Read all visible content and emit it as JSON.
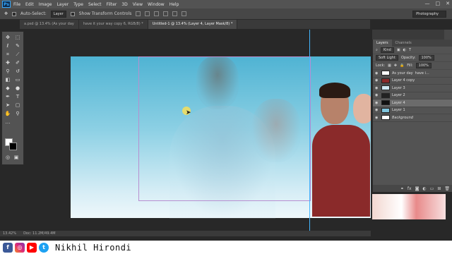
{
  "app": {
    "logo": "Ps",
    "menu": [
      "File",
      "Edit",
      "Image",
      "Layer",
      "Type",
      "Select",
      "Filter",
      "3D",
      "View",
      "Window",
      "Help"
    ],
    "window_controls": [
      "—",
      "□",
      "✕"
    ]
  },
  "options_bar": {
    "auto_select_label": "Auto-Select:",
    "auto_select_value": "Layer",
    "transform_label": "Show Transform Controls",
    "workspace": "Photography"
  },
  "tabs": [
    {
      "label": "a.psd @ 13.4% (As your day",
      "active": false
    },
    {
      "label": "have it your way copy 6, RGB/8) *",
      "active": false
    },
    {
      "label": "Untitled-1 @ 13.4% (Layer 4, Layer Mask/8) *",
      "active": true
    }
  ],
  "statusbar": {
    "zoom": "13.42%",
    "doc": "Doc: 11.2M/49.4M"
  },
  "layers_panel": {
    "tabs": [
      "Layers",
      "Channels"
    ],
    "kind_label": "Kind",
    "blend_mode": "Soft Light",
    "opacity_label": "Opacity:",
    "opacity_value": "100%",
    "lock_label": "Lock:",
    "fill_label": "Fill:",
    "fill_value": "100%",
    "layers": [
      {
        "name": "As your day",
        "extra": "have i...",
        "selected": false,
        "visible": true
      },
      {
        "name": "Layer 4 copy",
        "extra": "",
        "selected": false,
        "visible": true
      },
      {
        "name": "Layer 3",
        "extra": "",
        "selected": false,
        "visible": true
      },
      {
        "name": "Layer 2",
        "extra": "",
        "selected": false,
        "visible": true
      },
      {
        "name": "Layer 4",
        "extra": "",
        "selected": true,
        "visible": true
      },
      {
        "name": "Layer 1",
        "extra": "",
        "selected": false,
        "visible": true
      },
      {
        "name": "Background",
        "extra": "",
        "selected": false,
        "visible": true
      }
    ]
  },
  "footer": {
    "author": "Nikhil Hirondi"
  }
}
